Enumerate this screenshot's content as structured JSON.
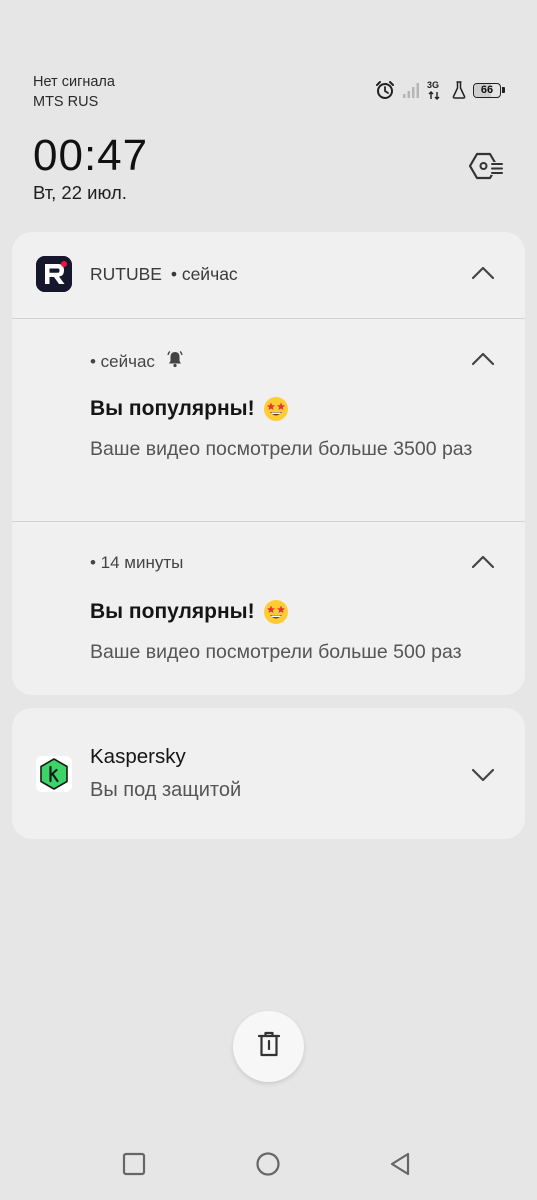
{
  "status_bar": {
    "signal_text": "Нет сигнала",
    "carrier": "MTS RUS",
    "network_type": "3G",
    "battery_level": "66",
    "icons": [
      "alarm-icon",
      "signal-icon",
      "network-3g-icon",
      "flask-icon",
      "battery-icon"
    ]
  },
  "header": {
    "time": "00:47",
    "date": "Вт, 22 июл.",
    "settings_icon": "notification-settings-icon"
  },
  "notifications": {
    "rutube": {
      "app_name": "RUTUBE",
      "header_time": "• сейчас",
      "icon": "rutube-logo",
      "items": [
        {
          "meta": "• сейчас",
          "title": "Вы популярны!",
          "body": "Ваше видео посмотрели больше 3500 раз"
        },
        {
          "meta": "• 14 минуты",
          "title": "Вы популярны!",
          "body": "Ваше видео посмотрели больше 500 раз"
        }
      ]
    },
    "kaspersky": {
      "app_name": "Kaspersky",
      "body": "Вы под защитой",
      "icon": "kaspersky-logo"
    }
  },
  "actions": {
    "clear_all_icon": "trash-icon"
  },
  "nav_bar": {
    "icons": [
      "recents-icon",
      "home-icon",
      "back-icon"
    ]
  },
  "colors": {
    "background": "#e6e6e6",
    "card": "#f0f0f0",
    "rutube_dark": "#16162d",
    "rutube_red": "#ed143b",
    "kaspersky_green": "#3cd466"
  }
}
